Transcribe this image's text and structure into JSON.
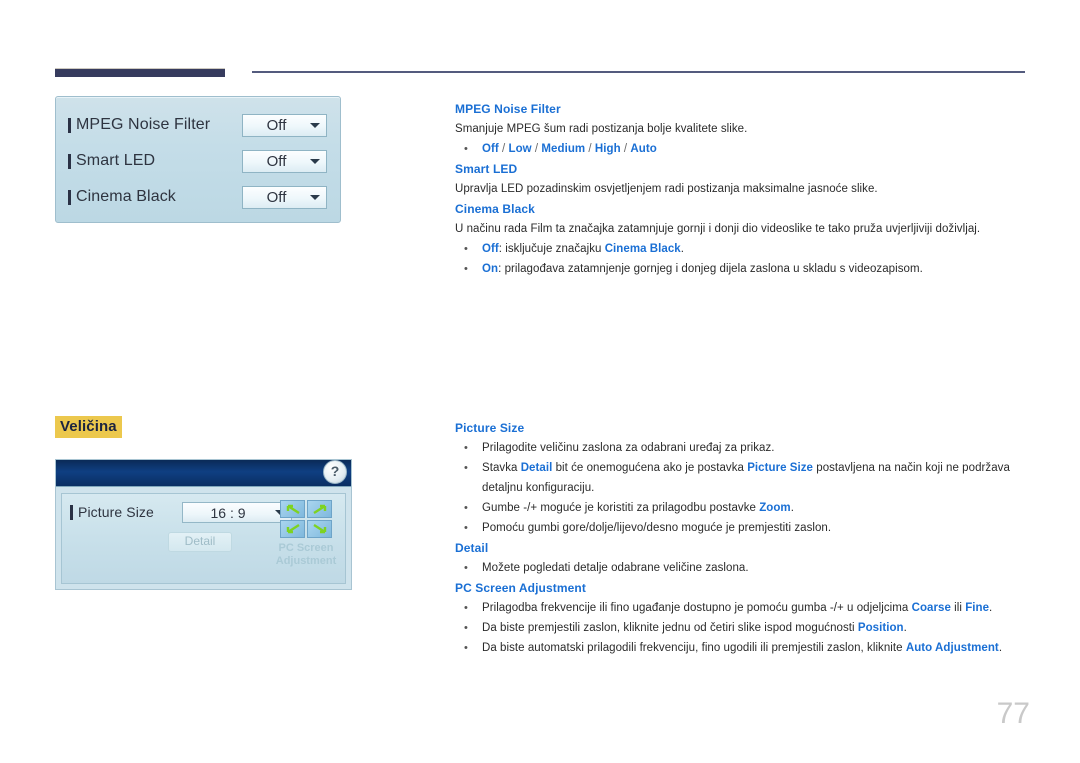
{
  "page": {
    "number": "77"
  },
  "osd_picture_options": {
    "rows": [
      {
        "label": "MPEG Noise Filter",
        "value": "Off"
      },
      {
        "label": "Smart LED",
        "value": "Off"
      },
      {
        "label": "Cinema Black",
        "value": "Off"
      }
    ]
  },
  "osd_size": {
    "help_icon": "?",
    "picture_size_label": "Picture Size",
    "picture_size_value": "16 : 9",
    "detail_button": "Detail",
    "pc_screen_adjustment_label": "PC Screen Adjustment"
  },
  "section_heading": {
    "text": "Veličina"
  },
  "sections_top": {
    "mpeg_noise_filter": {
      "title": "MPEG Noise Filter",
      "body": "Smanjuje MPEG šum radi postizanja bolje kvalitete slike.",
      "options": [
        "Off",
        "Low",
        "Medium",
        "High",
        "Auto"
      ],
      "option_separator": "/"
    },
    "smart_led": {
      "title": "Smart LED",
      "body": "Upravlja LED pozadinskim osvjetljenjem radi postizanja maksimalne jasnoće slike."
    },
    "cinema_black": {
      "title": "Cinema Black",
      "body": "U načinu rada Film ta značajka zatamnjuje gornji i donji dio videoslike te tako pruža uvjerljiviji doživljaj.",
      "bullet_off_key": "Off",
      "bullet_off_mid": ": isključuje značajku ",
      "bullet_off_ref": "Cinema Black",
      "bullet_off_end": ".",
      "bullet_on_key": "On",
      "bullet_on_text": ": prilagođava zatamnjenje gornjeg i donjeg dijela zaslona u skladu s videozapisom."
    }
  },
  "sections_bottom": {
    "picture_size": {
      "title": "Picture Size",
      "b1": "Prilagodite veličinu zaslona za odabrani uređaj za prikaz.",
      "b2_p1": "Stavka ",
      "b2_k1": "Detail",
      "b2_p2": " bit će onemogućena ako je postavka ",
      "b2_k2": "Picture Size",
      "b2_p3": " postavljena na način koji ne podržava detaljnu konfiguraciju.",
      "b3_p1": "Gumbe -/+ moguće je koristiti za prilagodbu postavke ",
      "b3_k1": "Zoom",
      "b3_p2": ".",
      "b4": "Pomoću gumbi gore/dolje/lijevo/desno moguće je premjestiti zaslon."
    },
    "detail": {
      "title": "Detail",
      "b1": "Možete pogledati detalje odabrane veličine zaslona."
    },
    "pc_screen_adjustment": {
      "title": "PC Screen Adjustment",
      "b1_p1": "Prilagodba frekvencije ili fino ugađanje dostupno je pomoću gumba -/+ u odjeljcima ",
      "b1_k1": "Coarse",
      "b1_p2": " ili ",
      "b1_k2": "Fine",
      "b1_p3": ".",
      "b2_p1": "Da biste premjestili zaslon, kliknite jednu od četiri slike ispod mogućnosti ",
      "b2_k1": "Position",
      "b2_p2": ".",
      "b3_p1": "Da biste automatski prilagodili frekvenciju, fino ugodili ili premjestili zaslon, kliknite ",
      "b3_k1": "Auto Adjustment",
      "b3_p2": "."
    }
  },
  "colors": {
    "accent_blue": "#1a6fd4",
    "heading_highlight": "#ecc84d",
    "rule_navy": "#363b5e",
    "page_number_gray": "#c9c9c9"
  }
}
